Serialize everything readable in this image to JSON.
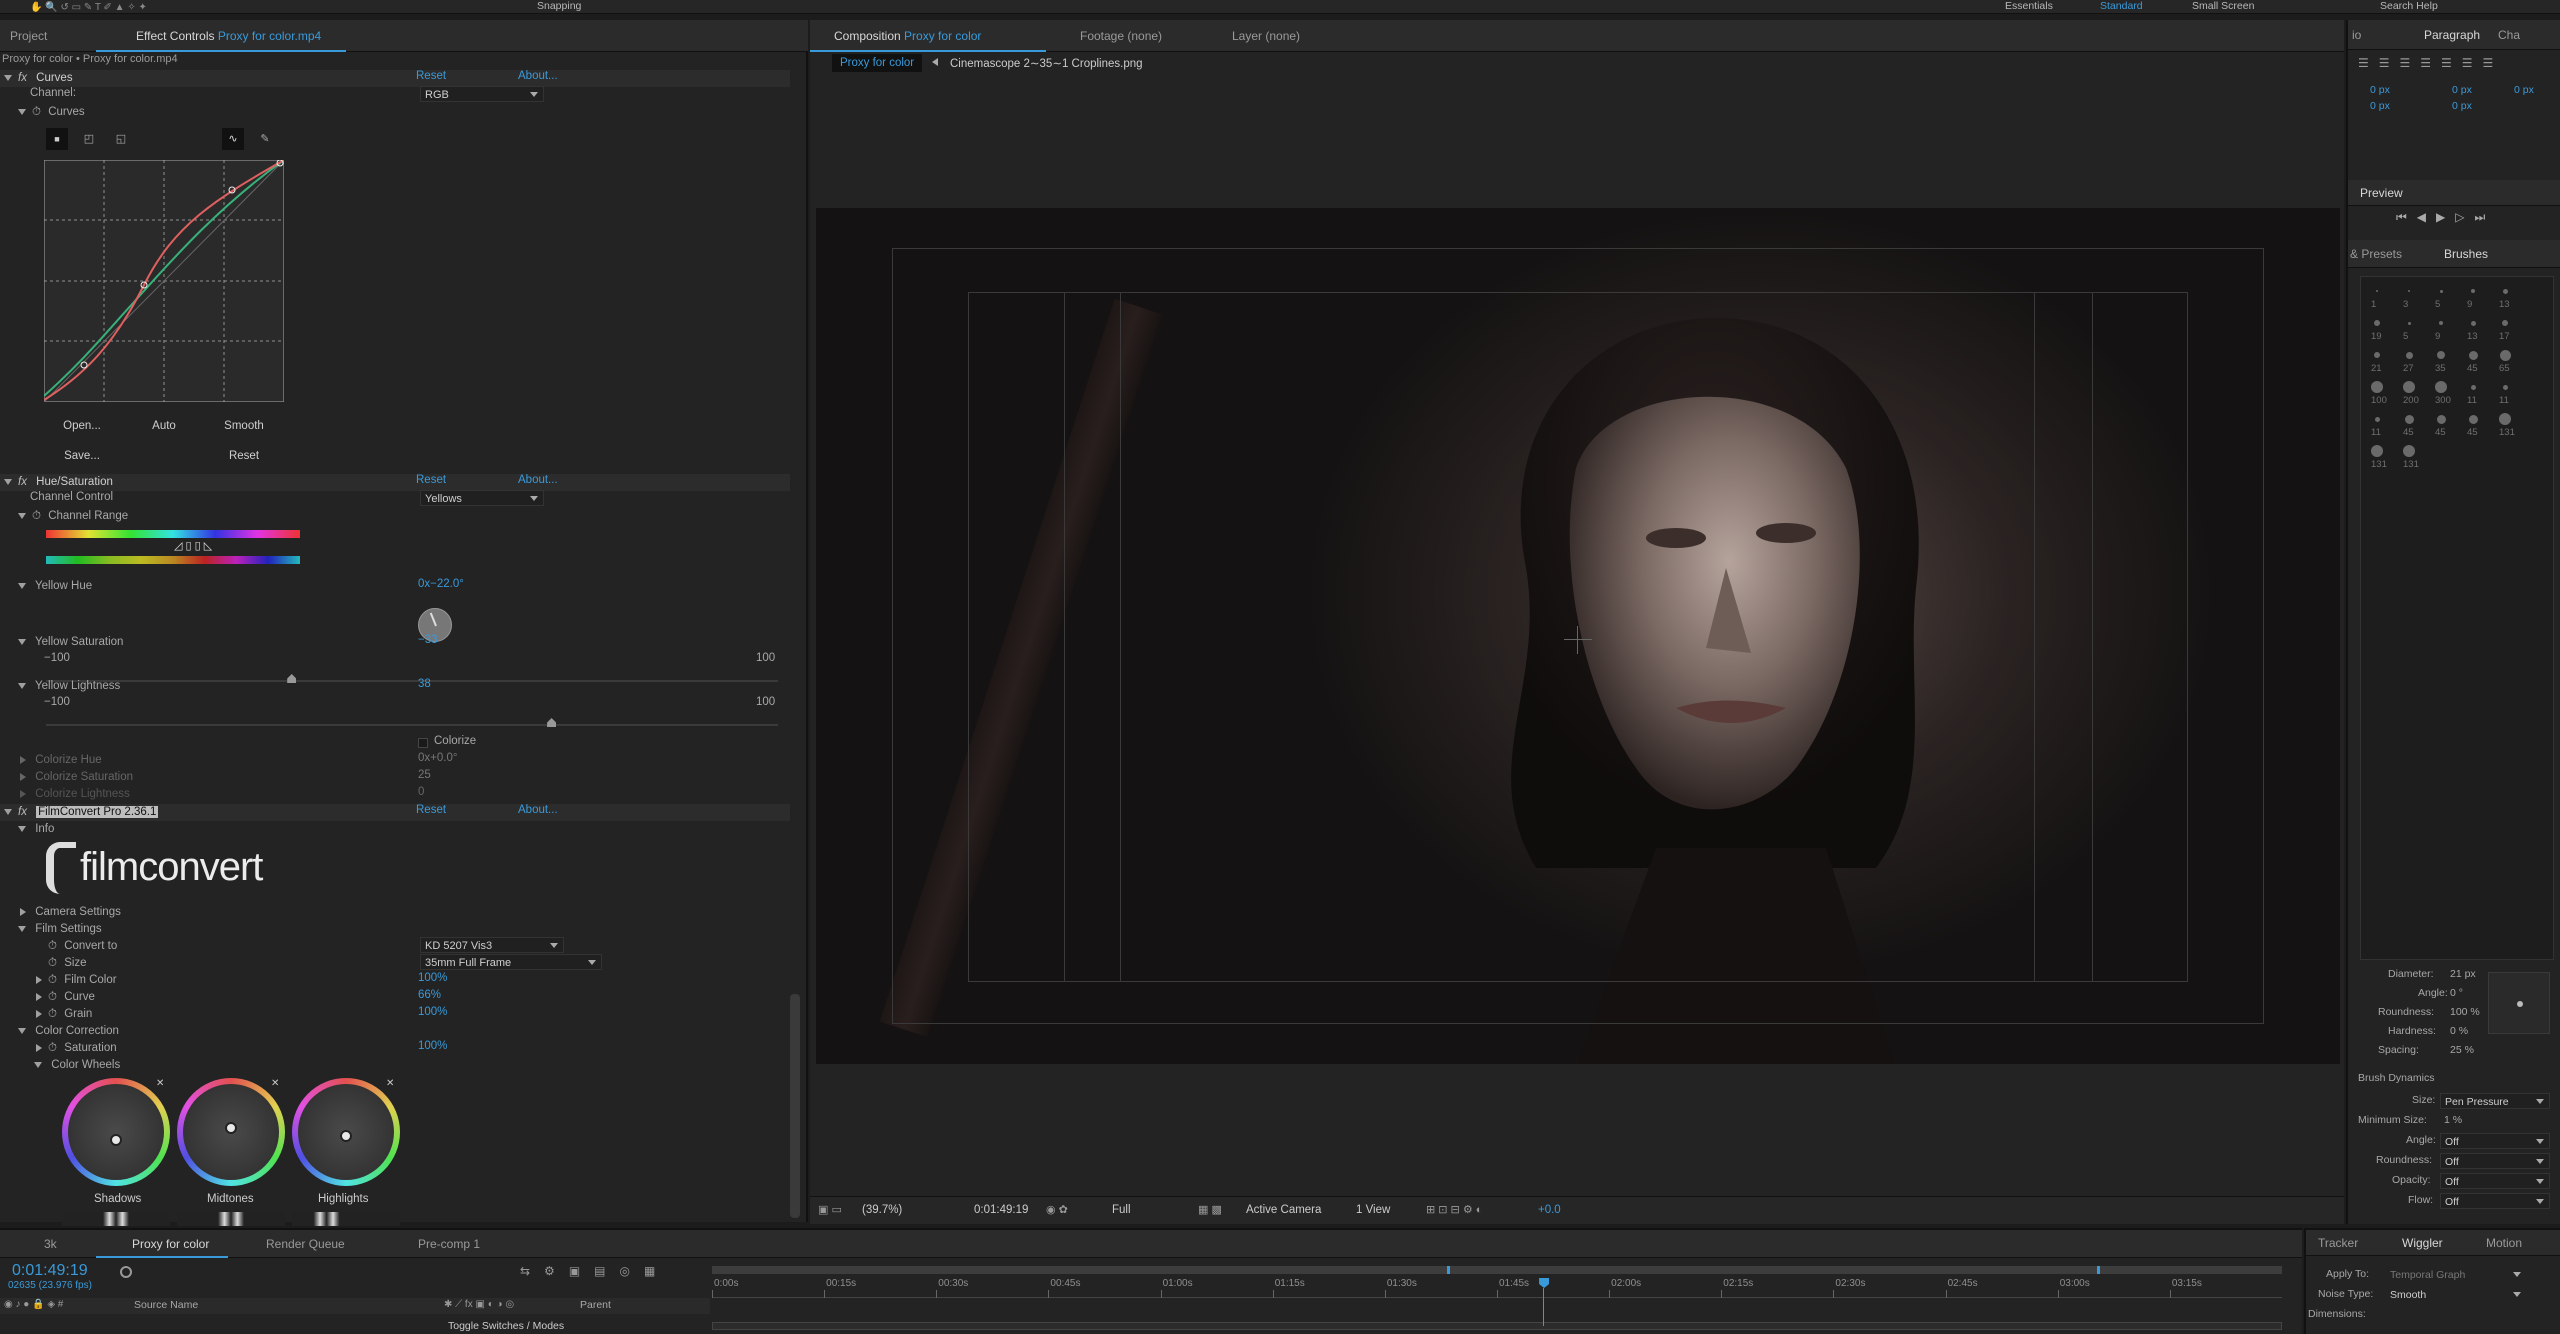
{
  "topbar": {
    "snapping": "Snapping",
    "workspaces": [
      "Essentials",
      "Standard",
      "Small Screen"
    ],
    "active_workspace": "Standard",
    "search_help": "Search Help"
  },
  "left_panel": {
    "tabs": {
      "project": "Project",
      "effect_controls": "Effect Controls",
      "effect_controls_file": "Proxy for color.mp4"
    },
    "breadcrumb": "Proxy for color • Proxy for color.mp4",
    "curves": {
      "name": "Curves",
      "reset": "Reset",
      "about": "About...",
      "channel_label": "Channel:",
      "channel_value": "RGB",
      "sub": "Curves",
      "buttons": {
        "open": "Open...",
        "auto": "Auto",
        "smooth": "Smooth",
        "save": "Save...",
        "reset": "Reset"
      }
    },
    "hue_sat": {
      "name": "Hue/Saturation",
      "reset": "Reset",
      "about": "About...",
      "channel_control_label": "Channel Control",
      "channel_control_value": "Yellows",
      "channel_range": "Channel Range",
      "yellow_hue_label": "Yellow Hue",
      "yellow_hue_value": "0x−22.0°",
      "yellow_sat_label": "Yellow Saturation",
      "yellow_sat_value": "−33",
      "yellow_sat_min": "−100",
      "yellow_sat_max": "100",
      "yellow_sat_level": 0.335,
      "yellow_light_label": "Yellow Lightness",
      "yellow_light_value": "38",
      "yellow_light_min": "−100",
      "yellow_light_max": "100",
      "yellow_light_level": 0.69,
      "colorize": "Colorize",
      "colorize_hue_label": "Colorize Hue",
      "colorize_hue_value": "0x+0.0°",
      "colorize_sat_label": "Colorize Saturation",
      "colorize_sat_value": "25",
      "colorize_light_label": "Colorize Lightness",
      "colorize_light_value": "0"
    },
    "filmconvert": {
      "name": "FilmConvert Pro 2.36.1",
      "reset": "Reset",
      "about": "About...",
      "info": "Info",
      "logo": "filmconvert",
      "camera_settings": "Camera Settings",
      "film_settings": "Film Settings",
      "convert_to_label": "Convert to",
      "convert_to_value": "KD 5207 Vis3",
      "size_label": "Size",
      "size_value": "35mm Full Frame",
      "film_color_label": "Film Color",
      "film_color_value": "100%",
      "curve_label": "Curve",
      "curve_value": "66%",
      "grain_label": "Grain",
      "grain_value": "100%",
      "color_correction": "Color Correction",
      "saturation_label": "Saturation",
      "saturation_value": "100%",
      "color_wheels": "Color Wheels",
      "wheels": [
        "Shadows",
        "Midtones",
        "Highlights"
      ]
    }
  },
  "composition": {
    "tabs": {
      "composition_label": "Composition",
      "composition_name": "Proxy for color",
      "footage": "Footage (none)",
      "layer": "Layer (none)"
    },
    "crumbs": [
      "Proxy for color",
      "Cinemascope 2∼35∼1 Croplines.png"
    ],
    "footer": {
      "zoom": "(39.7%)",
      "timecode": "0:01:49:19",
      "resolution": "Full",
      "camera": "Active Camera",
      "view": "1 View",
      "exposure": "+0.0"
    }
  },
  "right_panel": {
    "tabs_top": [
      "io",
      "Paragraph",
      "Cha"
    ],
    "paragraph_values": [
      "0 px",
      "0 px",
      "0 px",
      "0 px",
      "0 px"
    ],
    "preview": "Preview",
    "tabs_mid": [
      "& Presets",
      "Brushes"
    ],
    "brush_sizes": [
      "1",
      "3",
      "5",
      "9",
      "13",
      "19",
      "5",
      "9",
      "13",
      "17",
      "21",
      "27",
      "35",
      "45",
      "65",
      "100",
      "200",
      "300",
      "11",
      "11",
      "11",
      "45",
      "45",
      "45",
      "131",
      "131",
      "131"
    ],
    "brush_props": [
      {
        "label": "Diameter:",
        "value": "21 px"
      },
      {
        "label": "Angle:",
        "value": "0 °"
      },
      {
        "label": "Roundness:",
        "value": "100 %"
      },
      {
        "label": "Hardness:",
        "value": "0 %"
      },
      {
        "label": "Spacing:",
        "value": "25 %"
      }
    ],
    "brush_dynamics": "Brush Dynamics",
    "dynamics": [
      {
        "label": "Size:",
        "value": "Pen Pressure"
      },
      {
        "label": "Minimum Size:",
        "value": "1 %"
      },
      {
        "label": "Angle:",
        "value": "Off"
      },
      {
        "label": "Roundness:",
        "value": "Off"
      },
      {
        "label": "Opacity:",
        "value": "Off"
      },
      {
        "label": "Flow:",
        "value": "Off"
      }
    ]
  },
  "timeline": {
    "tabs": [
      "3k",
      "Proxy for color",
      "Render Queue",
      "Pre-comp 1"
    ],
    "timecode": "0:01:49:19",
    "frames": "02635 (23.976 fps)",
    "source_name": "Source Name",
    "parent": "Parent",
    "toggle": "Toggle Switches / Modes",
    "ruler": [
      "0:00s",
      "00:15s",
      "00:30s",
      "00:45s",
      "01:00s",
      "01:15s",
      "01:30s",
      "01:45s",
      "02:00s",
      "02:15s",
      "02:30s",
      "02:45s",
      "03:00s",
      "03:15s"
    ],
    "playhead_fraction": 0.53
  },
  "wiggler": {
    "tabs": [
      "Tracker",
      "Wiggler",
      "Motion"
    ],
    "apply_to_label": "Apply To:",
    "apply_to_value": "Temporal Graph",
    "noise_type_label": "Noise Type:",
    "noise_type_value": "Smooth",
    "dimensions_label": "Dimensions:"
  },
  "colors": {
    "accent": "#3a9ad9",
    "panel": "#232323",
    "header": "#2b2b2b"
  }
}
